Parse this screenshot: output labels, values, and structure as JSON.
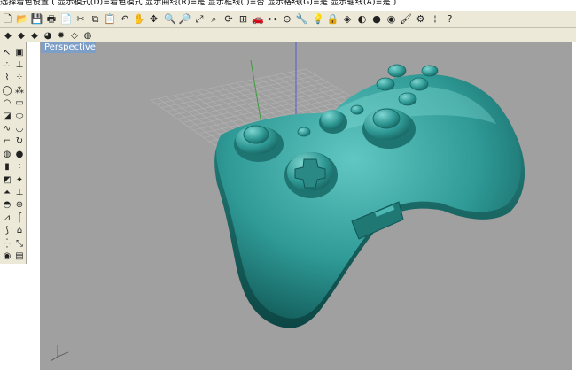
{
  "command_prompt": "选择着色设置 ( 显示模式(D)=着色模式 显示曲线(R)=是 显示框线(I)=否 显示格线(G)=是 显示轴线(A)=是 )",
  "viewport": {
    "tab_label": "Perspective"
  },
  "colors": {
    "viewport_bg": "#a0a0a0",
    "toolbar_bg": "#ece9d8",
    "tab_bg": "#7d9ec6",
    "model_teal": "#2f9a96",
    "grid_line": "#b4b4b4",
    "axis_green": "#3d9d3d",
    "axis_blue": "#5a5ad6"
  },
  "main_toolbar": [
    {
      "name": "new-file-icon",
      "glyph": "🗋"
    },
    {
      "name": "open-file-icon",
      "glyph": "📂"
    },
    {
      "name": "save-icon",
      "glyph": "💾"
    },
    {
      "name": "print-icon",
      "glyph": "🖶"
    },
    {
      "name": "copy-icon",
      "glyph": "📄"
    },
    {
      "name": "cut-icon",
      "glyph": "✂"
    },
    {
      "name": "copy-paste-icon",
      "glyph": "⧉"
    },
    {
      "name": "paste-icon",
      "glyph": "📋"
    },
    {
      "name": "undo-icon",
      "glyph": "↶"
    },
    {
      "name": "pan-icon",
      "glyph": "✋"
    },
    {
      "name": "move-icon",
      "glyph": "✥"
    },
    {
      "name": "zoom-icon",
      "glyph": "🔍"
    },
    {
      "name": "zoom-window-icon",
      "glyph": "🔎"
    },
    {
      "name": "zoom-extents-icon",
      "glyph": "⤢"
    },
    {
      "name": "zoom-selected-icon",
      "glyph": "⌕"
    },
    {
      "name": "refresh-icon",
      "glyph": "⟳"
    },
    {
      "name": "four-viewports-icon",
      "glyph": "⊞"
    },
    {
      "name": "car-icon",
      "glyph": "🚗"
    },
    {
      "name": "osnap-icon",
      "glyph": "⊶"
    },
    {
      "name": "select-icon",
      "glyph": "⊙"
    },
    {
      "name": "wrench-icon",
      "glyph": "🔧"
    },
    {
      "name": "light-bulb-icon",
      "glyph": "💡"
    },
    {
      "name": "lock-icon",
      "glyph": "🔒"
    },
    {
      "name": "layer-icon",
      "glyph": "◈"
    },
    {
      "name": "color-wheel-icon",
      "glyph": "◐"
    },
    {
      "name": "shaded-sphere-icon",
      "glyph": "●"
    },
    {
      "name": "render-sphere-icon",
      "glyph": "◉"
    },
    {
      "name": "brush-icon",
      "glyph": "🖌"
    },
    {
      "name": "gear-icon",
      "glyph": "⚙"
    },
    {
      "name": "network-icon",
      "glyph": "⊹"
    },
    {
      "name": "help-icon",
      "glyph": "?"
    }
  ],
  "secondary_toolbar": [
    {
      "name": "snap-end-icon",
      "glyph": "◆"
    },
    {
      "name": "snap-near-icon",
      "glyph": "◆"
    },
    {
      "name": "snap-point-icon",
      "glyph": "◆"
    },
    {
      "name": "shade-blue-icon",
      "glyph": "◕"
    },
    {
      "name": "sun-icon",
      "glyph": "✹"
    },
    {
      "name": "tag-icon",
      "glyph": "◇"
    },
    {
      "name": "history-icon",
      "glyph": "◍"
    }
  ],
  "palette_tools": [
    {
      "name": "select-arrow-icon",
      "glyph": "↖"
    },
    {
      "name": "solid-box-icon",
      "glyph": "▣"
    },
    {
      "name": "curve-point-icon",
      "glyph": "∴"
    },
    {
      "name": "dimension-icon",
      "glyph": "⊥"
    },
    {
      "name": "polyline-icon",
      "glyph": "⌇"
    },
    {
      "name": "transform-icon",
      "glyph": "⁘"
    },
    {
      "name": "circle-icon",
      "glyph": "◯"
    },
    {
      "name": "mesh-icon",
      "glyph": "⁂"
    },
    {
      "name": "arc-icon",
      "glyph": "◠"
    },
    {
      "name": "rectangle-icon",
      "glyph": "▭"
    },
    {
      "name": "box-cube-icon",
      "glyph": "◪"
    },
    {
      "name": "ellipse-icon",
      "glyph": "⬭"
    },
    {
      "name": "curve-icon",
      "glyph": "∿"
    },
    {
      "name": "cap-icon",
      "glyph": "◡"
    },
    {
      "name": "fillet-icon",
      "glyph": "⌐"
    },
    {
      "name": "rotate-icon",
      "glyph": "↻"
    },
    {
      "name": "sphere-icon",
      "glyph": "◍"
    },
    {
      "name": "blue-sphere-icon",
      "glyph": "●"
    },
    {
      "name": "cylinder-icon",
      "glyph": "▮"
    },
    {
      "name": "spheres-icon",
      "glyph": "⁘"
    },
    {
      "name": "surface-icon",
      "glyph": "◩"
    },
    {
      "name": "explode-icon",
      "glyph": "✦"
    },
    {
      "name": "loft-icon",
      "glyph": "⏶"
    },
    {
      "name": "extrude-icon",
      "glyph": "⊥"
    },
    {
      "name": "dup-edge-icon",
      "glyph": "◓"
    },
    {
      "name": "boolean-icon",
      "glyph": "⊛"
    },
    {
      "name": "offset-icon",
      "glyph": "⊿"
    },
    {
      "name": "pipe-icon",
      "glyph": "⌠"
    },
    {
      "name": "bend-icon",
      "glyph": "⟆"
    },
    {
      "name": "orient-icon",
      "glyph": "⌂"
    },
    {
      "name": "array-icon",
      "glyph": "⁛"
    },
    {
      "name": "scale-icon",
      "glyph": "⤡"
    },
    {
      "name": "analyze-icon",
      "glyph": "◉"
    },
    {
      "name": "render-icon",
      "glyph": "▤"
    }
  ]
}
